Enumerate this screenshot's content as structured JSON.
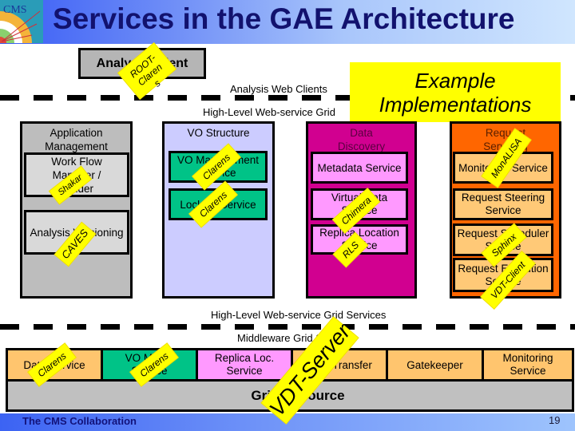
{
  "header": {
    "title": "Services in the GAE Architecture",
    "logo_text": "CMS"
  },
  "analysis_client": {
    "label": "Analysis Client",
    "sticker": "ROOT-Clarens"
  },
  "example_implementations": "Example Implementations",
  "layer_labels": {
    "analysis_web_clients": "Analysis Web Clients",
    "high_level_grid_top": "High-Level Web-service Grid",
    "high_level_grid_services": "High-Level Web-service Grid Services",
    "middleware_grid_services": "Middleware Grid Services"
  },
  "columns": [
    {
      "title": "Application Management",
      "color": "#bdbdbd",
      "services": [
        {
          "label": "Work Flow Manager / Builder",
          "sticker": "Shakar"
        },
        {
          "label": "Analysis Versioning",
          "sticker": "CAVES"
        }
      ]
    },
    {
      "title": "VO Structure",
      "color": "#ccccff",
      "services": [
        {
          "label": "VO Management Service",
          "sticker": "Clarens"
        },
        {
          "label": "Locking Service",
          "sticker": "Clarens"
        }
      ]
    },
    {
      "title": "Data Discovery",
      "color": "#d10090",
      "services": [
        {
          "label": "Metadata Service",
          "sticker": ""
        },
        {
          "label": "Virtual Data Service",
          "sticker": "Chimera"
        },
        {
          "label": "Replica Location Service",
          "sticker": "RLS"
        }
      ]
    },
    {
      "title": "Request Servicing",
      "color": "#ff6600",
      "services": [
        {
          "label": "Monitoring Service",
          "sticker": "MonALISA"
        },
        {
          "label": "Request Steering Service",
          "sticker": ""
        },
        {
          "label": "Request Scheduler Service",
          "sticker": "Sphinx"
        },
        {
          "label": "Request Execution Service",
          "sticker": "VDT-Client"
        }
      ]
    }
  ],
  "middleware": [
    {
      "label": "Data Service",
      "color": "#ffc56e",
      "sticker": "Clarens"
    },
    {
      "label": "VO Mgmt. Service",
      "color": "#00c387",
      "sticker": "Clarens"
    },
    {
      "label": "Replica Loc. Service",
      "color": "#ff99ff",
      "sticker": ""
    },
    {
      "label": "Data Transfer",
      "color": "#ffc56e",
      "sticker": ""
    },
    {
      "label": "Gatekeeper",
      "color": "#ffc56e",
      "sticker": ""
    },
    {
      "label": "Monitoring Service",
      "color": "#ffc56e",
      "sticker": ""
    }
  ],
  "grid_resource": {
    "label": "Grid Resource",
    "sticker": "VDT-Server"
  },
  "footer": {
    "organization": "The CMS Collaboration",
    "page_number": "19"
  }
}
